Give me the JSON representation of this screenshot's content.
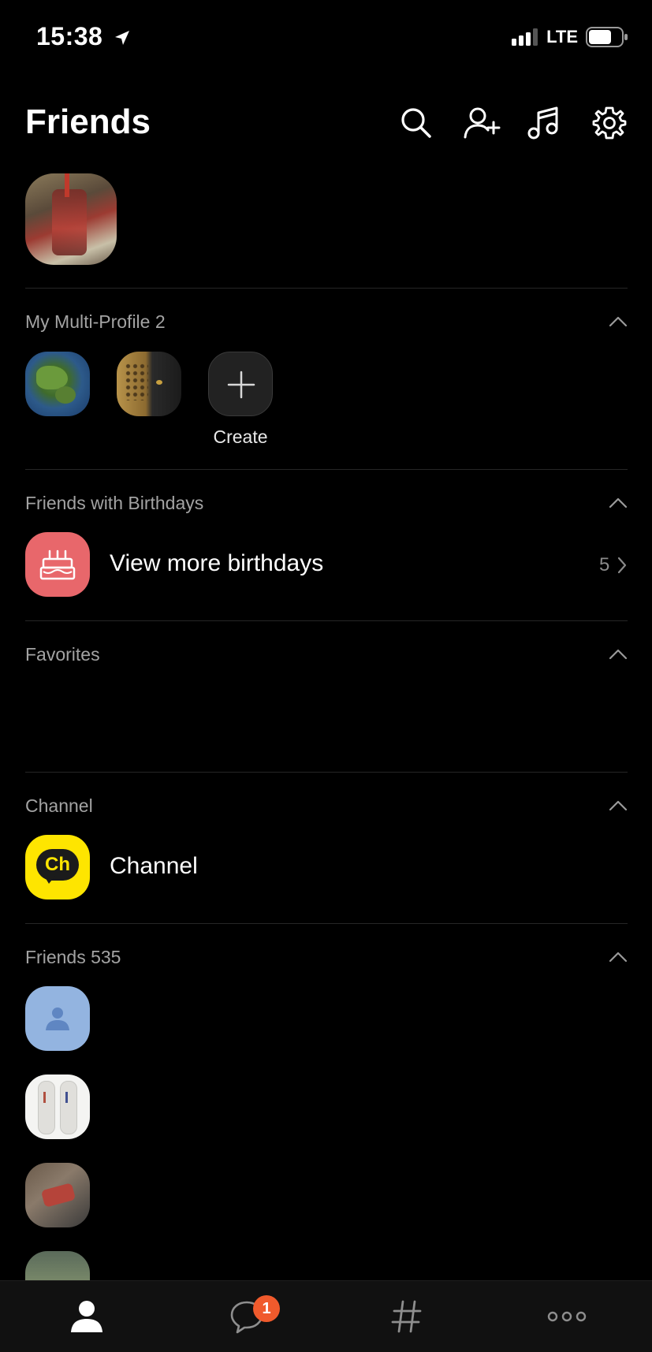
{
  "status": {
    "time": "15:38",
    "network": "LTE"
  },
  "header": {
    "title": "Friends"
  },
  "multi_profile": {
    "title": "My Multi-Profile 2",
    "create_label": "Create"
  },
  "birthdays": {
    "title": "Friends with Birthdays",
    "row_label": "View more birthdays",
    "count": "5"
  },
  "favorites": {
    "title": "Favorites"
  },
  "channel": {
    "title": "Channel",
    "row_label": "Channel",
    "logo_text": "Ch"
  },
  "friends": {
    "title": "Friends 535"
  },
  "tabbar": {
    "chats_badge": "1"
  },
  "colors": {
    "birthday_red": "#e8676b",
    "channel_yellow": "#fee500",
    "badge": "#f05a2c",
    "default_avatar": "#93b4e0"
  }
}
